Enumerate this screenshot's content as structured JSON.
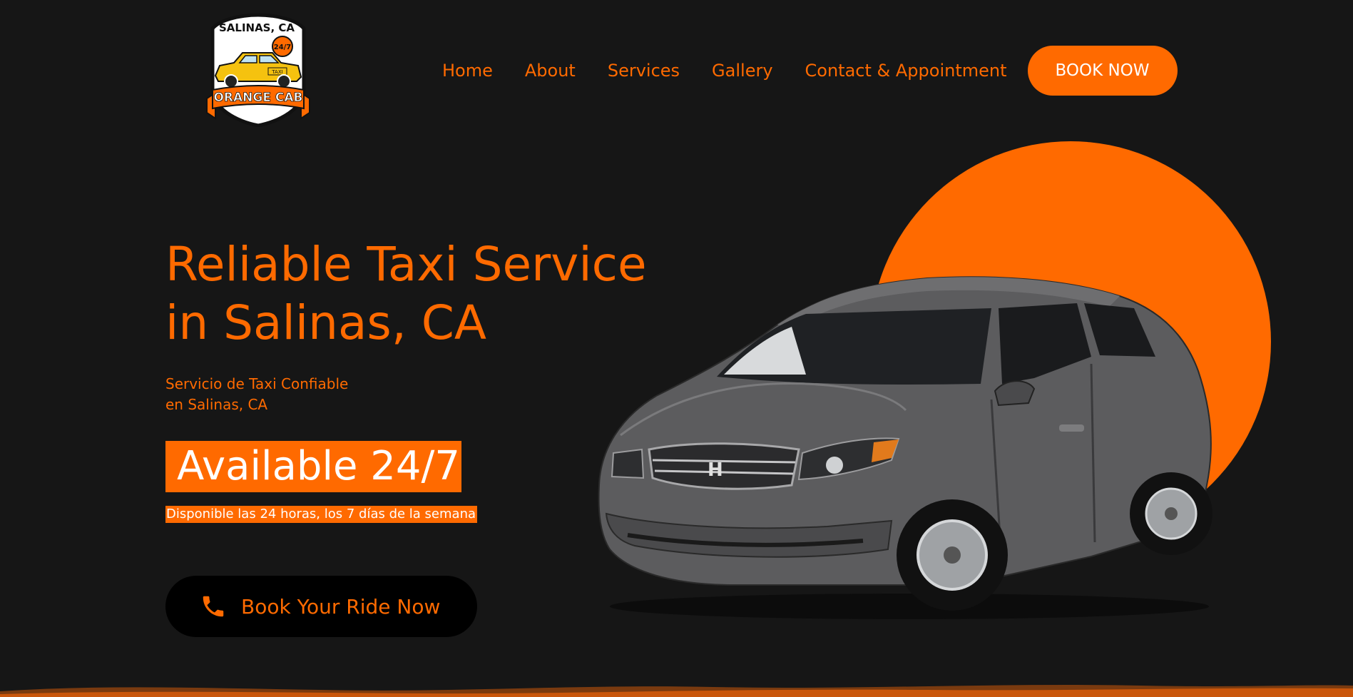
{
  "logo": {
    "top_text": "SALINAS, CA",
    "badge_text": "24/7",
    "taxi_sign": "TAXI",
    "banner_text": "ORANGE CAB"
  },
  "nav": {
    "items": [
      "Home",
      "About",
      "Services",
      "Gallery",
      "Contact & Appointment"
    ],
    "cta_label": "BOOK NOW"
  },
  "hero": {
    "title_line1": "Reliable Taxi Service",
    "title_line2": "in Salinas, CA",
    "subtitle_line1": "Servicio de Taxi Confiable",
    "subtitle_line2": "en Salinas, CA",
    "available": "Available 24/7",
    "disponible": "Disponible las 24 horas, los 7 días de la semana",
    "cta_label": "Book Your Ride Now",
    "cta_icon": "phone-icon"
  },
  "colors": {
    "accent": "#ff6a00",
    "background": "#161616",
    "button_dark": "#000000"
  }
}
